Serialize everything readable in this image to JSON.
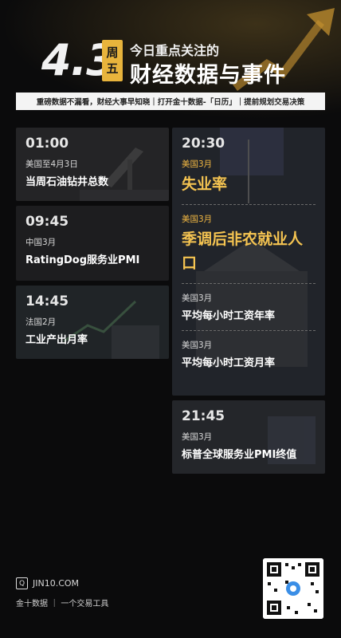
{
  "header": {
    "date": "4.3",
    "weekday_chars": [
      "周",
      "五"
    ],
    "headline_line1": "今日重点关注的",
    "headline_line2": "财经数据与事件",
    "tagline": "重磅数据不漏看，财经大事早知晓｜打开金十数据-「日历」｜提前规划交易决策"
  },
  "left_events": [
    {
      "time": "01:00",
      "region": "美国至4月3日",
      "title": "当周石油钻井总数"
    },
    {
      "time": "09:45",
      "region": "中国3月",
      "title": "RatingDog服务业PMI"
    },
    {
      "time": "14:45",
      "region": "法国2月",
      "title": "工业产出月率"
    }
  ],
  "right_block_1": {
    "time": "20:30",
    "items": [
      {
        "region": "美国3月",
        "title": "失业率"
      },
      {
        "region": "美国3月",
        "title": "季调后非农就业人口"
      },
      {
        "region": "美国3月",
        "title": "平均每小时工资年率"
      },
      {
        "region": "美国3月",
        "title": "平均每小时工资月率"
      }
    ]
  },
  "right_block_2": {
    "time": "21:45",
    "region": "美国3月",
    "title": "标普全球服务业PMI终值"
  },
  "footer": {
    "site": "JIN10.COM",
    "brand_slogan": "金十数据 ｜ 一个交易工具"
  },
  "colors": {
    "gold": "#f5c451",
    "background": "#0b0b0c",
    "card": "#1d1d1f"
  }
}
